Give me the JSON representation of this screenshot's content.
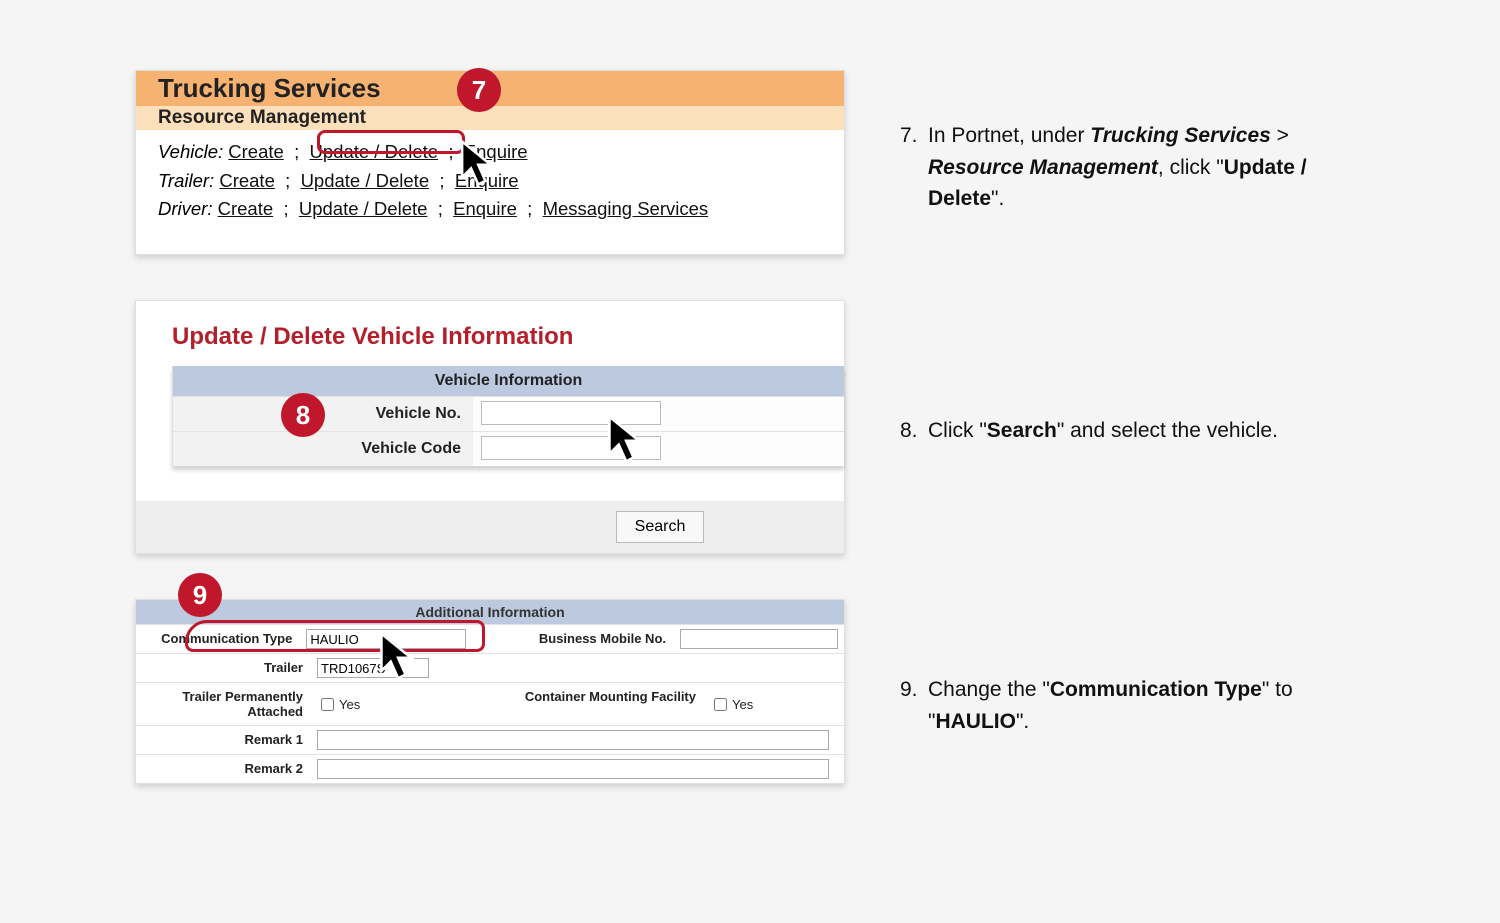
{
  "panel1": {
    "heading1": "Trucking Services",
    "heading2": "Resource Management",
    "vehicle_label": "Vehicle",
    "trailer_label": "Trailer",
    "driver_label": "Driver",
    "separator": ";",
    "links": {
      "create": "Create",
      "update_delete": "Update / Delete",
      "enquire": "Enquire",
      "messaging": "Messaging Services"
    },
    "badge7": "7"
  },
  "panel2": {
    "title": "Update / Delete Vehicle Information",
    "bluebar": "Vehicle Information",
    "vehicle_no_label": "Vehicle No.",
    "vehicle_code_label": "Vehicle Code",
    "search_button": "Search",
    "badge8": "8"
  },
  "panel3": {
    "bluebar": "Additional Information",
    "comm_type_label": "Communication Type",
    "comm_type_value": "HAULIO",
    "bm_label": "Business Mobile No.",
    "trailer_label": "Trailer",
    "trailer_value": "TRD1067S",
    "tpa_label": "Trailer Permanently Attached",
    "tpa_yes": "Yes",
    "cmf_label": "Container Mounting Facility",
    "cmf_yes": "Yes",
    "remark1_label": "Remark 1",
    "remark2_label": "Remark 2",
    "badge9": "9"
  },
  "instructions": {
    "step7": {
      "num": "7.",
      "pre": "In Portnet, under ",
      "bi1": "Trucking Services",
      "gt": " > ",
      "bi2": "Resource Management",
      "mid": ", click \"",
      "b1": "Update / Delete",
      "end": "\"."
    },
    "step8": {
      "num": "8.",
      "pre": "Click \"",
      "b1": "Search",
      "end": "\" and select the vehicle."
    },
    "step9": {
      "num": "9.",
      "pre": "Change the \"",
      "b1": "Communication Type",
      "mid": "\" to \"",
      "b2": "HAULIO",
      "end": "\"."
    }
  }
}
